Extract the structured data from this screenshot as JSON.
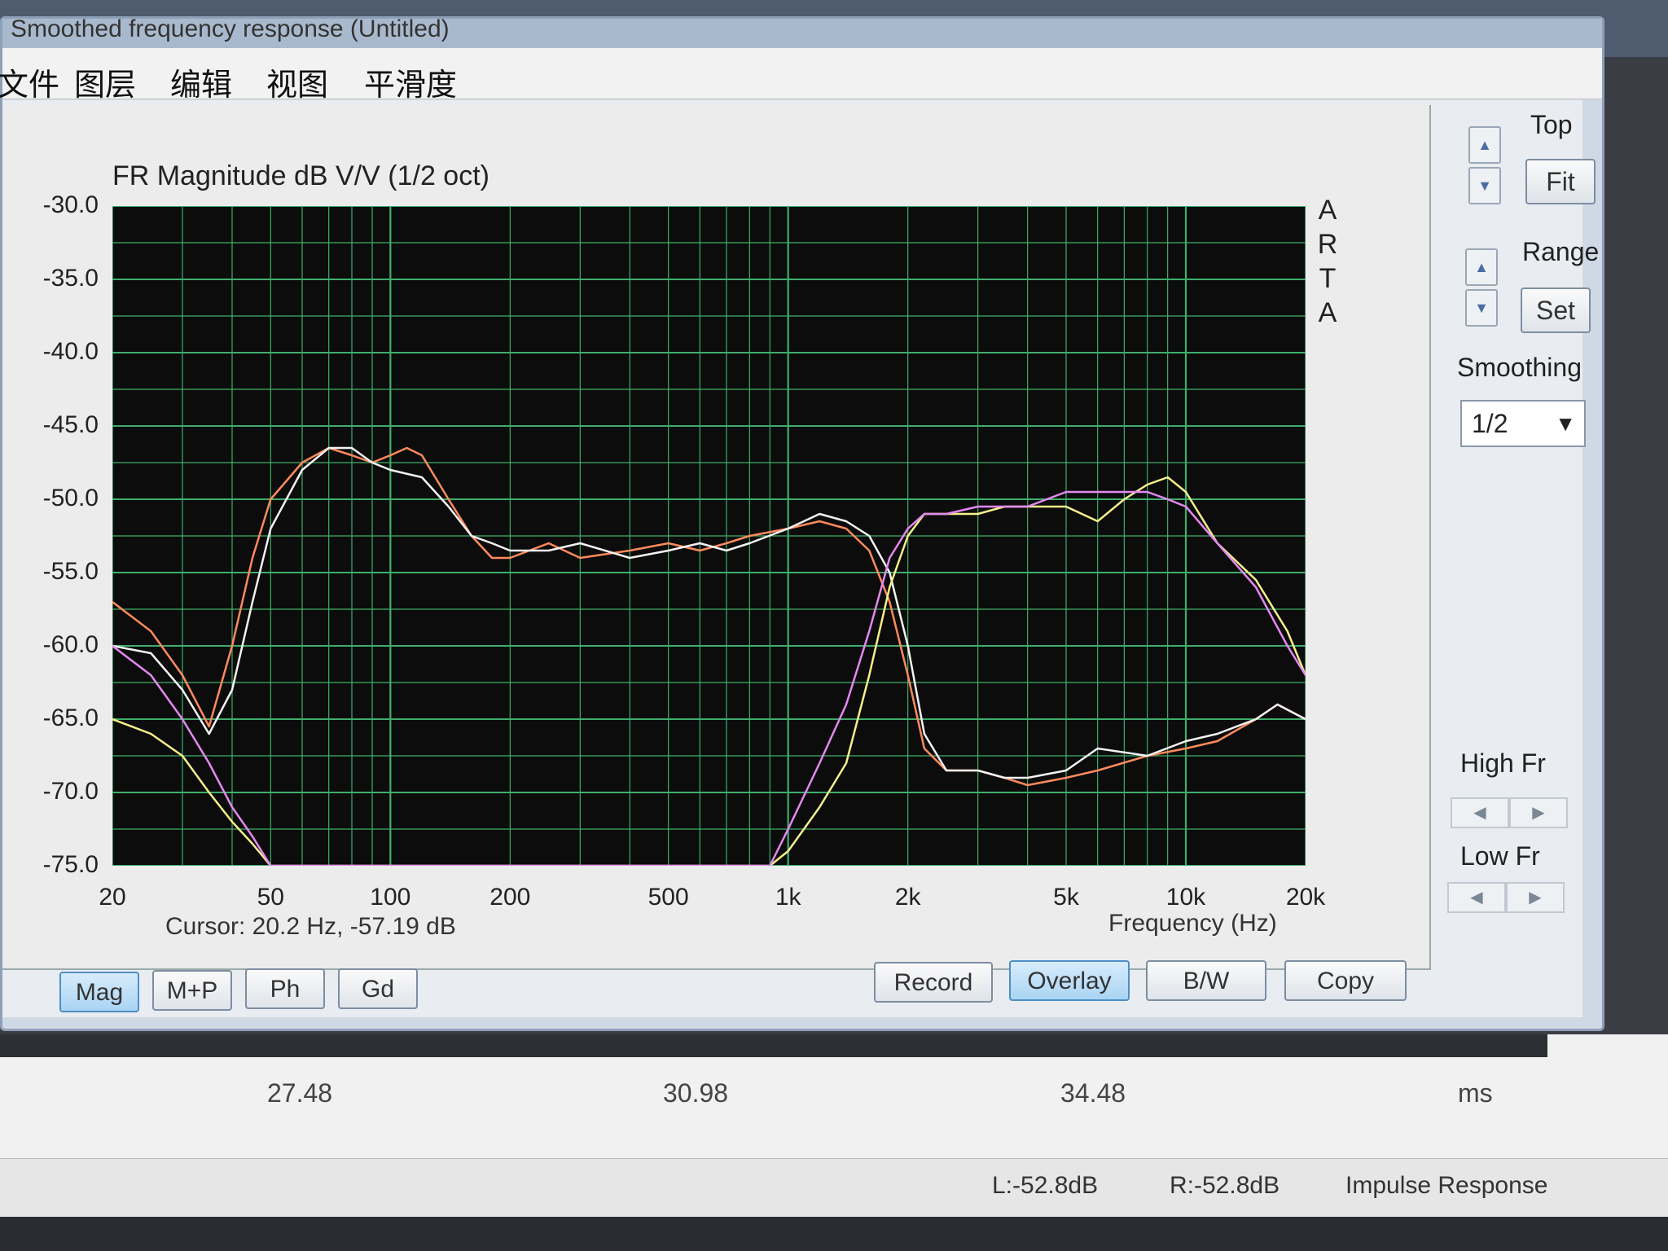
{
  "window": {
    "title": "Smoothed frequency response (Untitled)"
  },
  "menu": [
    "文件",
    "图层",
    "编辑",
    "视图",
    "平滑度"
  ],
  "plot": {
    "title": "FR Magnitude dB V/V (1/2 oct)",
    "y_ticks": [
      "-30.0",
      "-35.0",
      "-40.0",
      "-45.0",
      "-50.0",
      "-55.0",
      "-60.0",
      "-65.0",
      "-70.0",
      "-75.0"
    ],
    "x_ticks": [
      "20",
      "50",
      "100",
      "200",
      "500",
      "1k",
      "2k",
      "5k",
      "10k",
      "20k"
    ],
    "x_axis_label": "Frequency (Hz)",
    "side_text": [
      "A",
      "R",
      "T",
      "A"
    ],
    "cursor_readout": "Cursor: 20.2 Hz, -57.19 dB"
  },
  "chart_data": {
    "type": "line",
    "title": "FR Magnitude dB V/V (1/2 oct)",
    "xlabel": "Frequency (Hz)",
    "ylabel": "",
    "x_scale": "log",
    "xlim": [
      20,
      20000
    ],
    "ylim": [
      -75,
      -30
    ],
    "grid": true,
    "series": [
      {
        "color": "#ff8a5c",
        "points": [
          [
            20,
            -57
          ],
          [
            25,
            -59
          ],
          [
            30,
            -62
          ],
          [
            35,
            -65.5
          ],
          [
            40,
            -60
          ],
          [
            45,
            -54
          ],
          [
            50,
            -50
          ],
          [
            60,
            -47.5
          ],
          [
            70,
            -46.5
          ],
          [
            80,
            -47
          ],
          [
            90,
            -47.5
          ],
          [
            100,
            -47
          ],
          [
            110,
            -46.5
          ],
          [
            120,
            -47
          ],
          [
            140,
            -50
          ],
          [
            160,
            -52.5
          ],
          [
            180,
            -54
          ],
          [
            200,
            -54
          ],
          [
            250,
            -53
          ],
          [
            300,
            -54
          ],
          [
            400,
            -53.5
          ],
          [
            500,
            -53
          ],
          [
            600,
            -53.5
          ],
          [
            700,
            -53
          ],
          [
            800,
            -52.5
          ],
          [
            1000,
            -52
          ],
          [
            1200,
            -51.5
          ],
          [
            1400,
            -52
          ],
          [
            1600,
            -53.5
          ],
          [
            1800,
            -57
          ],
          [
            2000,
            -62
          ],
          [
            2200,
            -67
          ],
          [
            2500,
            -68.5
          ],
          [
            3000,
            -68.5
          ],
          [
            3500,
            -69
          ],
          [
            4000,
            -69.5
          ],
          [
            5000,
            -69
          ],
          [
            6000,
            -68.5
          ],
          [
            8000,
            -67.5
          ],
          [
            10000,
            -67
          ],
          [
            12000,
            -66.5
          ],
          [
            15000,
            -65
          ],
          [
            17000,
            -64
          ],
          [
            20000,
            -65
          ]
        ]
      },
      {
        "color": "#f2f2f2",
        "points": [
          [
            20,
            -60
          ],
          [
            25,
            -60.5
          ],
          [
            30,
            -63
          ],
          [
            35,
            -66
          ],
          [
            40,
            -63
          ],
          [
            45,
            -57
          ],
          [
            50,
            -52
          ],
          [
            60,
            -48
          ],
          [
            70,
            -46.5
          ],
          [
            80,
            -46.5
          ],
          [
            90,
            -47.5
          ],
          [
            100,
            -48
          ],
          [
            120,
            -48.5
          ],
          [
            140,
            -50.5
          ],
          [
            160,
            -52.5
          ],
          [
            180,
            -53
          ],
          [
            200,
            -53.5
          ],
          [
            250,
            -53.5
          ],
          [
            300,
            -53
          ],
          [
            400,
            -54
          ],
          [
            500,
            -53.5
          ],
          [
            600,
            -53
          ],
          [
            700,
            -53.5
          ],
          [
            800,
            -53
          ],
          [
            1000,
            -52
          ],
          [
            1200,
            -51
          ],
          [
            1400,
            -51.5
          ],
          [
            1600,
            -52.5
          ],
          [
            1800,
            -55
          ],
          [
            2000,
            -60
          ],
          [
            2200,
            -66
          ],
          [
            2500,
            -68.5
          ],
          [
            3000,
            -68.5
          ],
          [
            3500,
            -69
          ],
          [
            4000,
            -69
          ],
          [
            5000,
            -68.5
          ],
          [
            6000,
            -67
          ],
          [
            8000,
            -67.5
          ],
          [
            10000,
            -66.5
          ],
          [
            12000,
            -66
          ],
          [
            15000,
            -65
          ],
          [
            17000,
            -64
          ],
          [
            20000,
            -65
          ]
        ]
      },
      {
        "color": "#f4f08a",
        "points": [
          [
            20,
            -65
          ],
          [
            25,
            -66
          ],
          [
            30,
            -67.5
          ],
          [
            35,
            -70
          ],
          [
            40,
            -72
          ],
          [
            45,
            -73.5
          ],
          [
            50,
            -75
          ],
          [
            900,
            -75
          ],
          [
            1000,
            -74
          ],
          [
            1200,
            -71
          ],
          [
            1400,
            -68
          ],
          [
            1600,
            -62
          ],
          [
            1800,
            -56
          ],
          [
            2000,
            -52.5
          ],
          [
            2200,
            -51
          ],
          [
            2500,
            -51
          ],
          [
            3000,
            -51
          ],
          [
            3500,
            -50.5
          ],
          [
            4000,
            -50.5
          ],
          [
            5000,
            -50.5
          ],
          [
            6000,
            -51.5
          ],
          [
            7000,
            -50
          ],
          [
            8000,
            -49
          ],
          [
            9000,
            -48.5
          ],
          [
            10000,
            -49.5
          ],
          [
            12000,
            -53
          ],
          [
            15000,
            -55.5
          ],
          [
            18000,
            -59
          ],
          [
            20000,
            -62
          ]
        ]
      },
      {
        "color": "#e488f0",
        "points": [
          [
            20,
            -60
          ],
          [
            25,
            -62
          ],
          [
            30,
            -65
          ],
          [
            35,
            -68
          ],
          [
            40,
            -71
          ],
          [
            45,
            -73
          ],
          [
            50,
            -75
          ],
          [
            900,
            -75
          ],
          [
            1000,
            -72.5
          ],
          [
            1200,
            -68
          ],
          [
            1400,
            -64
          ],
          [
            1600,
            -59
          ],
          [
            1800,
            -54
          ],
          [
            2000,
            -52
          ],
          [
            2200,
            -51
          ],
          [
            2500,
            -51
          ],
          [
            3000,
            -50.5
          ],
          [
            3500,
            -50.5
          ],
          [
            4000,
            -50.5
          ],
          [
            5000,
            -49.5
          ],
          [
            6000,
            -49.5
          ],
          [
            7000,
            -49.5
          ],
          [
            8000,
            -49.5
          ],
          [
            9000,
            -50
          ],
          [
            10000,
            -50.5
          ],
          [
            12000,
            -53
          ],
          [
            15000,
            -56
          ],
          [
            18000,
            -60
          ],
          [
            20000,
            -62
          ]
        ]
      }
    ]
  },
  "bottom_buttons": {
    "mag": "Mag",
    "mp": "M+P",
    "ph": "Ph",
    "gd": "Gd",
    "record": "Record",
    "overlay": "Overlay",
    "bw": "B/W",
    "copy": "Copy"
  },
  "side_panel": {
    "top_label": "Top",
    "fit_label": "Fit",
    "range_label": "Range",
    "set_label": "Set",
    "smoothing_label": "Smoothing",
    "smoothing_value": "1/2",
    "high_fr_label": "High Fr",
    "low_fr_label": "Low Fr"
  },
  "background_window": {
    "time_ticks": [
      "27.48",
      "30.98",
      "34.48"
    ],
    "time_unit": "ms",
    "status_left": "L:-52.8dB",
    "status_right": "R:-52.8dB",
    "status_view": "Impulse Response"
  }
}
